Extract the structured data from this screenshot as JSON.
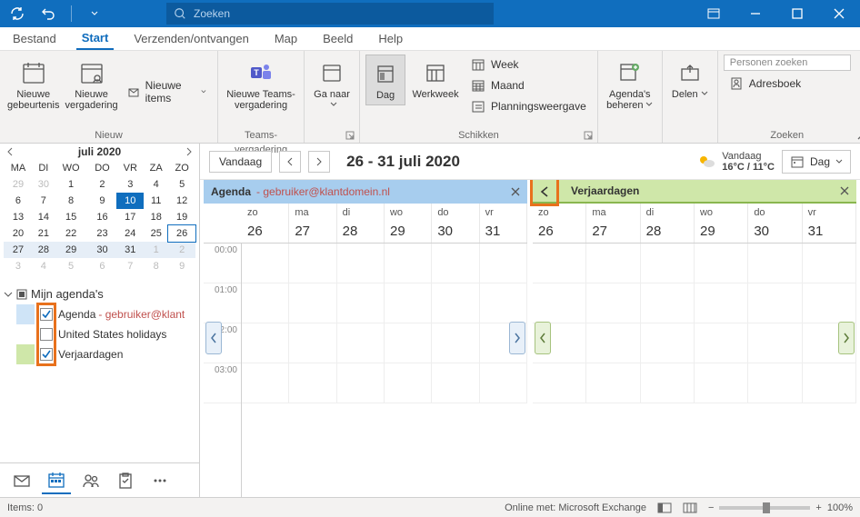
{
  "title_bar": {
    "search_placeholder": "Zoeken"
  },
  "menu": {
    "file": "Bestand",
    "home": "Start",
    "sendrecv": "Verzenden/ontvangen",
    "folder": "Map",
    "view": "Beeld",
    "help": "Help"
  },
  "ribbon": {
    "new_group": "Nieuw",
    "new_event": "Nieuwe gebeurtenis",
    "new_meeting": "Nieuwe vergadering",
    "new_items": "Nieuwe items",
    "teams_group": "Teams-vergadering",
    "teams_meeting": "Nieuwe Teams-vergadering",
    "goto_group": "Ga naar",
    "goto_btn": "Ga naar",
    "arrange_group": "Schikken",
    "day": "Dag",
    "workweek": "Werkweek",
    "week": "Week",
    "month": "Maand",
    "schedule": "Planningsweergave",
    "manage_group": "Agenda's beheren",
    "manage_btn": "Agenda's beheren",
    "share_group": "Delen",
    "share_btn": "Delen",
    "find_group": "Zoeken",
    "find_people": "Personen zoeken",
    "addressbook": "Adresboek"
  },
  "mini_cal": {
    "title": "juli 2020",
    "dow": [
      "MA",
      "DI",
      "WO",
      "DO",
      "VR",
      "ZA",
      "ZO"
    ],
    "weeks": [
      {
        "days": [
          29,
          30,
          1,
          2,
          3,
          4,
          5
        ],
        "otherStart": 0,
        "otherEnd": 1
      },
      {
        "days": [
          6,
          7,
          8,
          9,
          10,
          11,
          12
        ],
        "today": 4
      },
      {
        "days": [
          13,
          14,
          15,
          16,
          17,
          18,
          19
        ]
      },
      {
        "days": [
          20,
          21,
          22,
          23,
          24,
          25,
          26
        ],
        "sel": 6
      },
      {
        "days": [
          27,
          28,
          29,
          30,
          31,
          1,
          2
        ],
        "range": true,
        "otherStart": 5,
        "otherEnd": 6
      },
      {
        "days": [
          3,
          4,
          5,
          6,
          7,
          8,
          9
        ],
        "otherStart": 0,
        "otherEnd": 6
      }
    ]
  },
  "my_calendars": {
    "title": "Mijn agenda's",
    "items": [
      {
        "label": "Agenda",
        "detail": "gebruiker@klant",
        "checked": true,
        "color": "blue"
      },
      {
        "label": "United States holidays",
        "checked": false,
        "color": "none"
      },
      {
        "label": "Verjaardagen",
        "checked": true,
        "color": "green"
      }
    ]
  },
  "toolbar": {
    "today": "Vandaag",
    "range": "26 - 31 juli 2020",
    "weather_label": "Vandaag",
    "weather_temp": "16°C / 11°C",
    "view": "Dag"
  },
  "panes": [
    {
      "title": "Agenda",
      "subtitle": "gebruiker@klantdomein.nl",
      "color": "blue"
    },
    {
      "title": "Verjaardagen",
      "color": "green",
      "arrow": true
    }
  ],
  "days": {
    "dow": [
      "zo",
      "ma",
      "di",
      "wo",
      "do",
      "vr"
    ],
    "nums": [
      26,
      27,
      28,
      29,
      30,
      31
    ]
  },
  "hours": [
    "00:00",
    "01:00",
    "02:00",
    "03:00"
  ],
  "status": {
    "items": "Items: 0",
    "online": "Online met: Microsoft Exchange",
    "zoom": "100%"
  }
}
